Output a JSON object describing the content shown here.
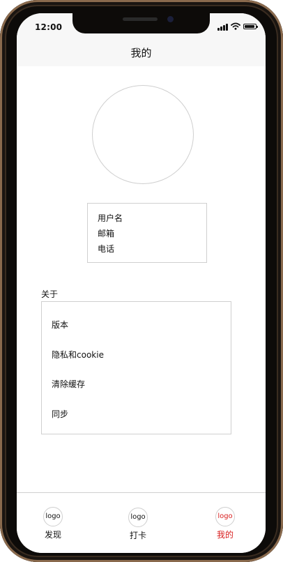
{
  "status": {
    "time": "12:00",
    "icons": [
      "signal-icon",
      "wifi-icon",
      "battery-icon"
    ]
  },
  "header": {
    "title": "我的"
  },
  "profile": {
    "avatar": "avatar-placeholder",
    "username": "用户名",
    "email": "邮箱",
    "phone": "电话"
  },
  "about": {
    "label": "关于",
    "items": [
      "版本",
      "隐私和cookie",
      "清除缓存",
      "同步"
    ]
  },
  "tabbar": {
    "accent_color": "#d81e1e",
    "active_tab": "我的",
    "tabs": [
      {
        "icon_text": "logo",
        "label": "发现"
      },
      {
        "icon_text": "logo",
        "label": "打卡"
      },
      {
        "icon_text": "logo",
        "label": "我的"
      }
    ]
  }
}
